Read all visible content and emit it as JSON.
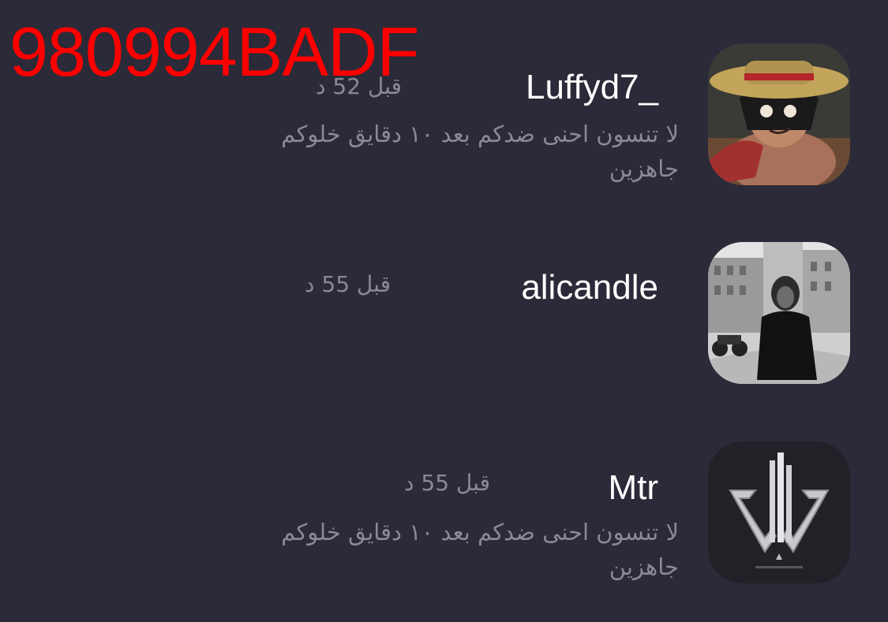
{
  "overlay_code": "980994BADF",
  "notifications": [
    {
      "username": "Luffyd7_",
      "time": "قبل 52 د",
      "message": "لا تنسون احنى ضدكم بعد ١٠ دقايق خلوكم جاهزين",
      "avatar_icon": "anime-character-avatar"
    },
    {
      "username": "alicandle",
      "time": "قبل 55 د",
      "message": "",
      "avatar_icon": "street-photo-avatar"
    },
    {
      "username": "Mtr",
      "time": "قبل 55 د",
      "message": "لا تنسون احنى ضدكم بعد ١٠ دقايق خلوكم جاهزين",
      "avatar_icon": "esports-logo-avatar"
    }
  ]
}
